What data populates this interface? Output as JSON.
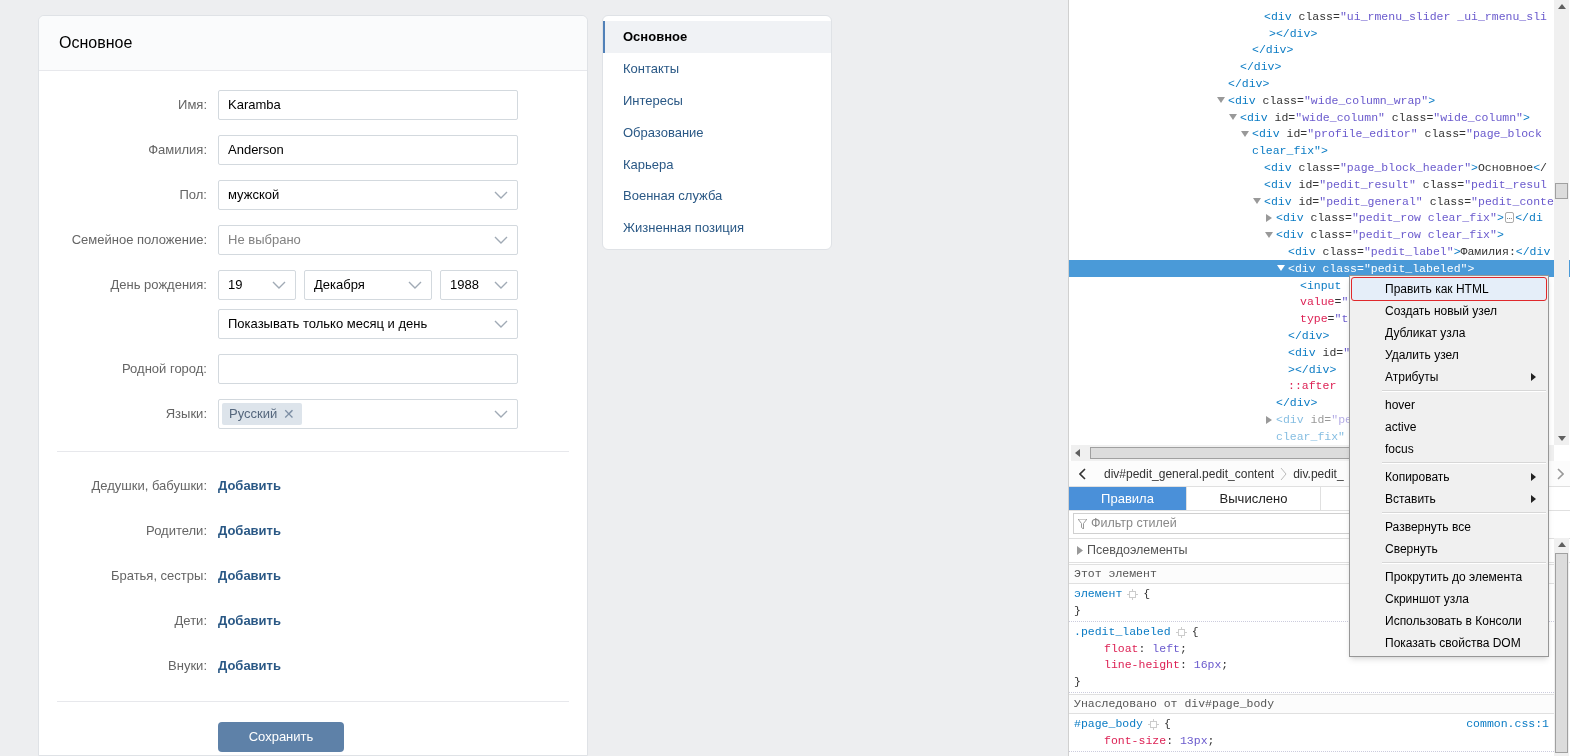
{
  "profile_form": {
    "title": "Основное",
    "fields": [
      {
        "kind": "text",
        "label": "Имя:",
        "value": "Karamba"
      },
      {
        "kind": "text",
        "label": "Фамилия:",
        "value": "Anderson"
      },
      {
        "kind": "select",
        "label": "Пол:",
        "value": "мужской"
      },
      {
        "kind": "select",
        "label": "Семейное положение:",
        "placeholder": "Не выбрано"
      },
      {
        "kind": "birthday",
        "label": "День рождения:",
        "day": "19",
        "month": "Декабря",
        "year": "1988",
        "visibility": "Показывать только месяц и день"
      },
      {
        "kind": "text",
        "label": "Родной город:"
      },
      {
        "kind": "tags",
        "label": "Языки:",
        "tags": [
          "Русский"
        ],
        "remove": "✕"
      }
    ],
    "relatives": [
      {
        "label": "Дедушки, бабушки:",
        "action": "Добавить"
      },
      {
        "label": "Родители:",
        "action": "Добавить"
      },
      {
        "label": "Братья, сестры:",
        "action": "Добавить"
      },
      {
        "label": "Дети:",
        "action": "Добавить"
      },
      {
        "label": "Внуки:",
        "action": "Добавить"
      }
    ],
    "save_button": "Сохранить"
  },
  "side_menu": [
    {
      "label": "Основное",
      "selected": true
    },
    {
      "label": "Контакты",
      "selected": false
    },
    {
      "label": "Интересы",
      "selected": false
    },
    {
      "label": "Образование",
      "selected": false
    },
    {
      "label": "Карьера",
      "selected": false
    },
    {
      "label": "Военная служба",
      "selected": false
    },
    {
      "label": "Жизненная позиция",
      "selected": false
    }
  ],
  "devtools": {
    "markup": [
      {
        "children": [
          {
            "children": [
              {
                "children": [
                  {
                    "text": "<div class=\"ui_rmenu_slider _ui_rmenu_sli",
                    "continuation": [
                      "></div>"
                    ]
                  }
                ],
                "closing": "</div>"
              }
            ],
            "closing": "</div>"
          }
        ],
        "closing": "</div>"
      },
      {
        "text": "<div class=\"wide_column_wrap\">",
        "expanded": true,
        "children": [
          {
            "text": "<div id=\"wide_column\" class=\"wide_column\">",
            "expanded": true,
            "children": [
              {
                "text": "<div id=\"profile_editor\" class=\"page_block",
                "continuation": [
                  "clear_fix\">"
                ],
                "expanded": true,
                "children": [
                  {
                    "text": "<div class=\"page_block_header\">Основное</"
                  },
                  {
                    "text": "<div id=\"pedit_result\" class=\"pedit_resul"
                  },
                  {
                    "text": "<div id=\"pedit_general\" class=\"pedit_conte",
                    "expanded": true,
                    "children": [
                      {
                        "text": "<div class=\"pedit_row clear_fix\">",
                        "expanded": false,
                        "badge": "…",
                        "tail": "</di"
                      },
                      {
                        "text": "<div class=\"pedit_row clear_fix\">",
                        "expanded": true,
                        "children": [
                          {
                            "text": "<div class=\"pedit_label\">Фамилия:</div"
                          },
                          {
                            "text": "<div class=\"pedit_labeled\">",
                            "expanded": true,
                            "selected": true,
                            "children": [
                              {
                                "text": "<input",
                                "continuation": [
                                  "value=\"",
                                  "type=\"t"
                                ]
                              }
                            ],
                            "closing": "</div>"
                          },
                          {
                            "text": "<div id=\"",
                            "continuation": [
                              "></div>"
                            ]
                          },
                          {
                            "text": "::after"
                          }
                        ],
                        "closing": "</div>"
                      },
                      {
                        "text": "<div id=\"pe",
                        "continuation": [
                          "clear_fix\""
                        ],
                        "expanded": false,
                        "dimmed": true
                      }
                    ]
                  }
                ]
              }
            ]
          }
        ]
      }
    ],
    "breadcrumbs": [
      "div#pedit_general.pedit_content",
      "div.pedit_"
    ],
    "tabs": [
      {
        "label": "Правила",
        "selected": true
      },
      {
        "label": "Вычислено",
        "selected": false
      }
    ],
    "filter": {
      "placeholder": "Фильтр стилей"
    },
    "pseudo_section": "Псевдоэлементы",
    "rules": [
      {
        "kind": "header",
        "text": "Этот элемент"
      },
      {
        "kind": "rule",
        "selector": "элемент",
        "open": "{",
        "close": "}"
      },
      {
        "kind": "rule",
        "selector": ".pedit_labeled",
        "open": "{",
        "close": "}",
        "declarations": [
          {
            "property": "float:",
            "value": "left;"
          },
          {
            "property": "line-height:",
            "value": "16px;"
          }
        ]
      },
      {
        "kind": "header",
        "text": "Унаследовано от div#page_body"
      },
      {
        "kind": "rule",
        "selector": "#page_body",
        "open": "{",
        "source": "common.css:1",
        "declarations": [
          {
            "property": "font-size:",
            "value": "13px;"
          }
        ]
      }
    ],
    "context_menu": [
      [
        {
          "label": "Править как HTML",
          "highlighted": true,
          "submenu": false
        },
        {
          "label": "Создать новый узел",
          "highlighted": false,
          "submenu": false
        },
        {
          "label": "Дубликат узла",
          "highlighted": false,
          "submenu": false
        },
        {
          "label": "Удалить узел",
          "highlighted": false,
          "submenu": false
        },
        {
          "label": "Атрибуты",
          "highlighted": false,
          "submenu": true
        }
      ],
      [
        {
          "label": "hover",
          "highlighted": false,
          "submenu": false
        },
        {
          "label": "active",
          "highlighted": false,
          "submenu": false
        },
        {
          "label": "focus",
          "highlighted": false,
          "submenu": false
        }
      ],
      [
        {
          "label": "Копировать",
          "highlighted": false,
          "submenu": true
        },
        {
          "label": "Вставить",
          "highlighted": false,
          "submenu": true
        }
      ],
      [
        {
          "label": "Развернуть все",
          "highlighted": false,
          "submenu": false
        },
        {
          "label": "Свернуть",
          "highlighted": false,
          "submenu": false
        }
      ],
      [
        {
          "label": "Прокрутить до элемента",
          "highlighted": false,
          "submenu": false
        },
        {
          "label": "Скриншот узла",
          "highlighted": false,
          "submenu": false
        },
        {
          "label": "Использовать в Консоли",
          "highlighted": false,
          "submenu": false
        },
        {
          "label": "Показать свойства DOM",
          "highlighted": false,
          "submenu": false
        }
      ]
    ]
  }
}
